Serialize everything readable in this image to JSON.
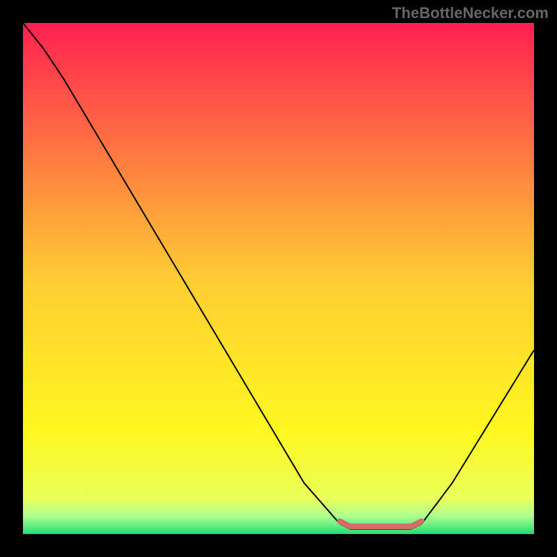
{
  "watermark": "TheBottleNecker.com",
  "chart_data": {
    "type": "line",
    "title": "",
    "xlabel": "",
    "ylabel": "",
    "xlim": [
      0,
      100
    ],
    "ylim": [
      0,
      100
    ],
    "series": [
      {
        "name": "bottleneck-curve",
        "color": "#000000",
        "stroke_width": 2,
        "points": [
          {
            "x": 0,
            "y": 100
          },
          {
            "x": 4,
            "y": 95
          },
          {
            "x": 8,
            "y": 89
          },
          {
            "x": 55,
            "y": 10
          },
          {
            "x": 62,
            "y": 2
          },
          {
            "x": 64,
            "y": 1
          },
          {
            "x": 76,
            "y": 1
          },
          {
            "x": 78,
            "y": 2
          },
          {
            "x": 84,
            "y": 10
          },
          {
            "x": 100,
            "y": 36
          }
        ]
      },
      {
        "name": "optimal-range",
        "color": "#d66b6b",
        "stroke_width": 8,
        "points": [
          {
            "x": 62,
            "y": 2.5
          },
          {
            "x": 64,
            "y": 1.5
          },
          {
            "x": 76,
            "y": 1.5
          },
          {
            "x": 78,
            "y": 2.5
          }
        ]
      }
    ],
    "background": {
      "type": "vertical-gradient",
      "stops": [
        {
          "offset": 0.0,
          "color": "#ff2050"
        },
        {
          "offset": 0.5,
          "color": "#ffcc33"
        },
        {
          "offset": 0.8,
          "color": "#fff820"
        },
        {
          "offset": 0.93,
          "color": "#eaff5a"
        },
        {
          "offset": 0.965,
          "color": "#b0ff90"
        },
        {
          "offset": 1.0,
          "color": "#20e070"
        }
      ]
    }
  }
}
